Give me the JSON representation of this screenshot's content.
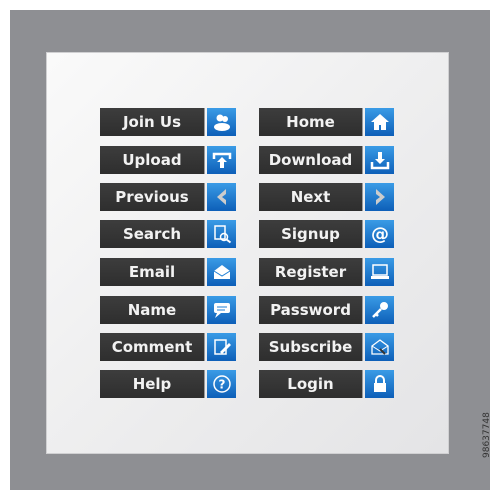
{
  "stock_number": "98637748",
  "colors": {
    "frame": "#8e8f93",
    "button": "#353535",
    "icon": "#1f7fd4"
  },
  "left": [
    {
      "label": "Join Us",
      "icon": "users-icon"
    },
    {
      "label": "Upload",
      "icon": "upload-icon"
    },
    {
      "label": "Previous",
      "icon": "chevron-left-icon"
    },
    {
      "label": "Search",
      "icon": "search-document-icon"
    },
    {
      "label": "Email",
      "icon": "envelope-icon"
    },
    {
      "label": "Name",
      "icon": "chat-bubble-icon"
    },
    {
      "label": "Comment",
      "icon": "edit-document-icon"
    },
    {
      "label": "Help",
      "icon": "question-icon"
    }
  ],
  "right": [
    {
      "label": "Home",
      "icon": "home-icon"
    },
    {
      "label": "Download",
      "icon": "download-icon"
    },
    {
      "label": "Next",
      "icon": "chevron-right-icon"
    },
    {
      "label": "Signup",
      "icon": "at-icon"
    },
    {
      "label": "Register",
      "icon": "laptop-icon"
    },
    {
      "label": "Password",
      "icon": "key-icon"
    },
    {
      "label": "Subscribe",
      "icon": "envelope-open-icon"
    },
    {
      "label": "Login",
      "icon": "lock-icon"
    }
  ]
}
